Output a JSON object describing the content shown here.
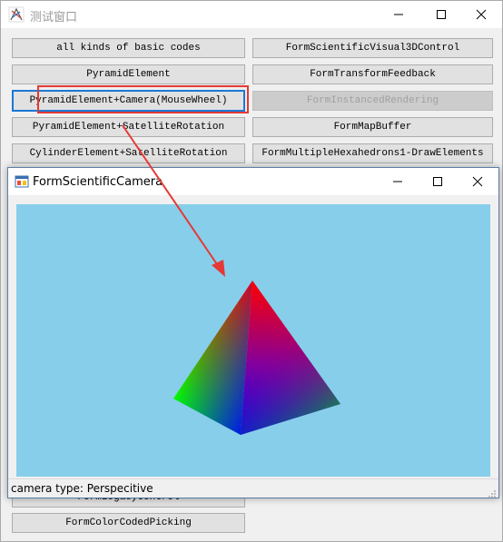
{
  "outer_window": {
    "title": "测试窗口",
    "controls": {
      "minimize": "—",
      "maximize": "☐",
      "close": "✕"
    }
  },
  "buttons": {
    "basic_codes": "all kinds of basic codes",
    "scientific_visual_3d": "FormScientificVisual3DControl",
    "pyramid_element": "PyramidElement",
    "transform_feedback": "FormTransformFeedback",
    "pyramid_camera": "PyramidElement+Camera(MouseWheel)",
    "instanced_rendering": "FormInstancedRendering",
    "pyramid_satellite": "PyramidElement+SatelliteRotation",
    "map_buffer": "FormMapBuffer",
    "cylinder_satellite": "CylinderElement+SatelliteRotation",
    "multiple_hexahedrons": "FormMultipleHexahedrons1-DrawElements",
    "partially_hidden": "FormLegacyControl",
    "color_coded_picking": "FormColorCodedPicking"
  },
  "inner_window": {
    "title": "FormScientificCamera",
    "controls": {
      "minimize": "—",
      "maximize": "☐",
      "close": "✕"
    },
    "status": "camera type: Perspecitive"
  },
  "colors": {
    "canvas_bg": "#87ceeb",
    "highlight": "#e53935",
    "arrow": "#e53935",
    "focus_border": "#1a78d6",
    "pyramid_top": "#ff0000",
    "pyramid_left": "#00ff00",
    "pyramid_bottom": "#0000ff"
  },
  "icons": {
    "outer_app": "app-logo-icon",
    "inner_app": "windows-form-icon"
  }
}
